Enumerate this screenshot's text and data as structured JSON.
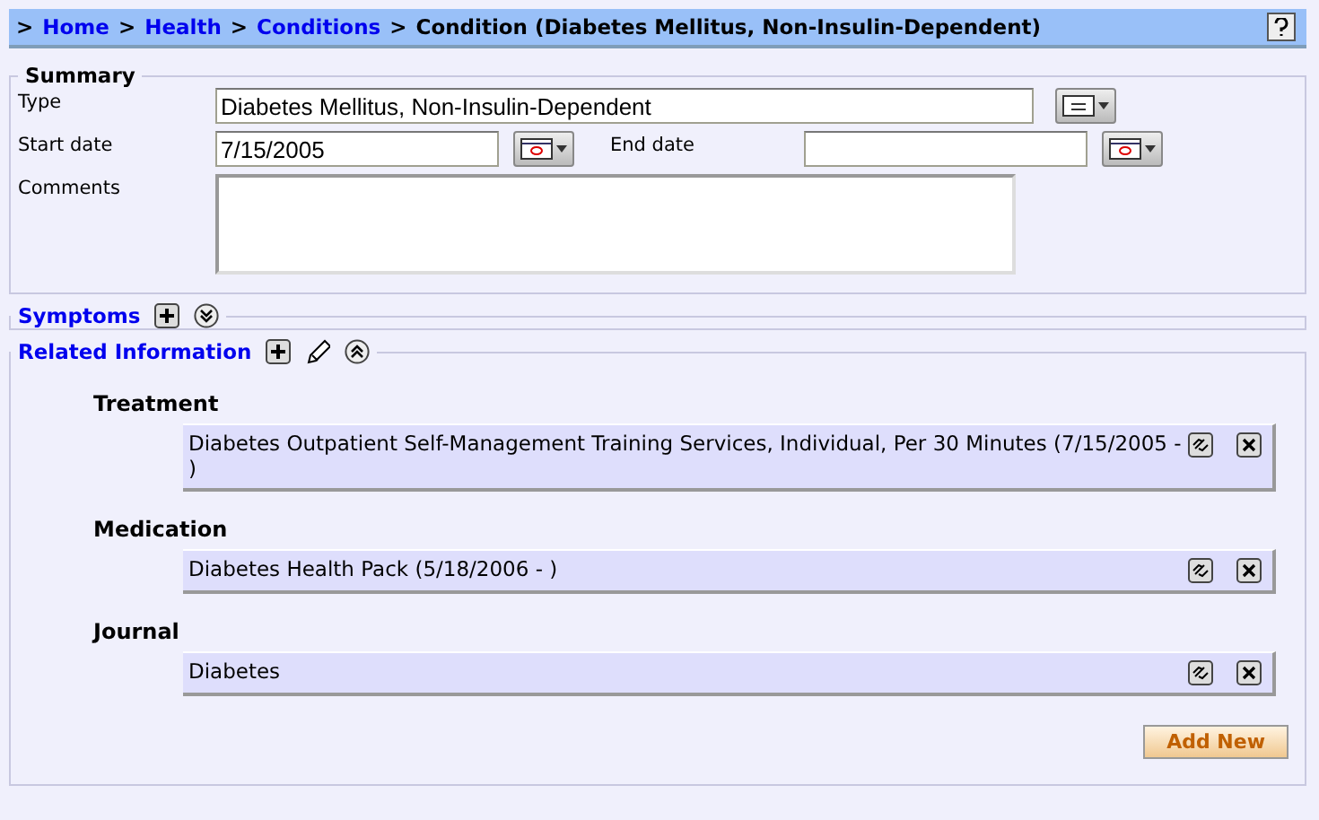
{
  "breadcrumb": {
    "separator": ">",
    "links": [
      "Home",
      "Health",
      "Conditions"
    ],
    "current": "Condition (Diabetes Mellitus, Non-Insulin-Dependent)"
  },
  "summary": {
    "title": "Summary",
    "type": {
      "label": "Type",
      "value": "Diabetes Mellitus, Non-Insulin-Dependent"
    },
    "start_date": {
      "label": "Start date",
      "value": "7/15/2005"
    },
    "end_date": {
      "label": "End date"
    },
    "comments": {
      "label": "Comments"
    }
  },
  "sections": [
    {
      "title": "Symptoms",
      "expanded": false,
      "editable": false
    },
    {
      "title": "Related Information",
      "expanded": true,
      "editable": true,
      "groups": [
        {
          "title": "Treatment",
          "items": [
            "Diabetes Outpatient Self-Management Training Services, Individual, Per 30 Minutes (7/15/2005 - )"
          ]
        },
        {
          "title": "Medication",
          "items": [
            "Diabetes Health Pack (5/18/2006 - )"
          ]
        },
        {
          "title": "Journal",
          "items": [
            "Diabetes"
          ]
        }
      ],
      "button": "Add New"
    }
  ]
}
